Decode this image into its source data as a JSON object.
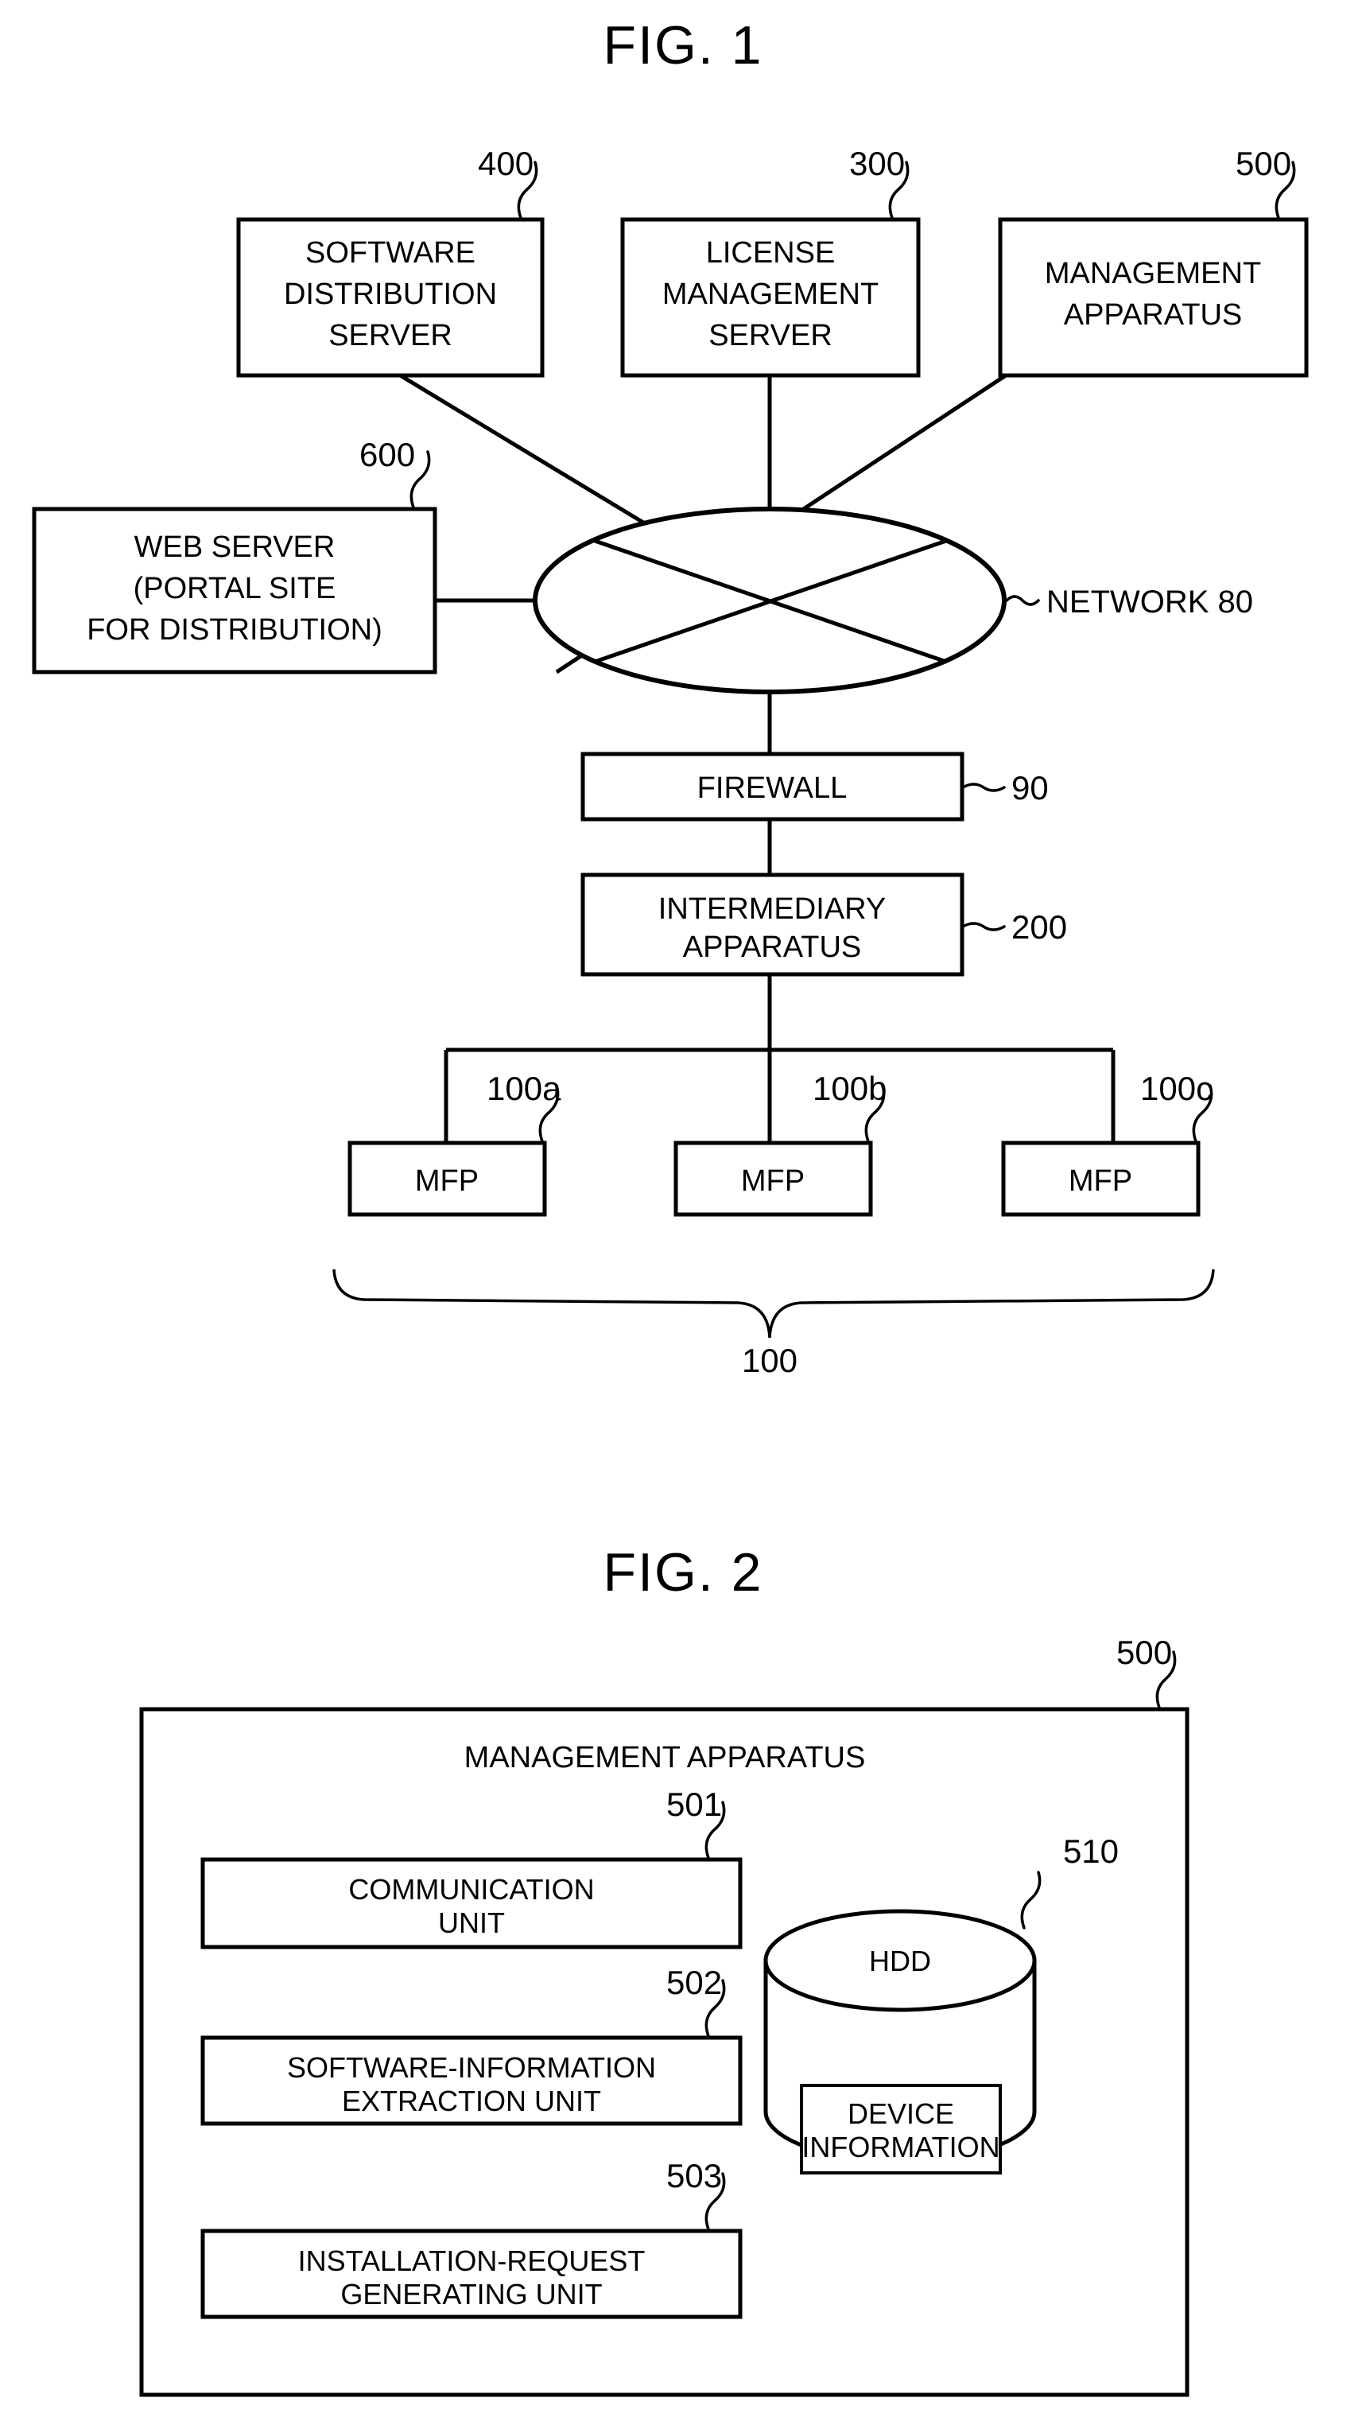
{
  "page": {
    "background": "#ffffff",
    "ink": "#000000"
  },
  "figures": [
    {
      "id": "fig1",
      "title": "FIG. 1",
      "nodes": {
        "software_distribution_server": {
          "label_lines": [
            "SOFTWARE",
            "DISTRIBUTION",
            "SERVER"
          ],
          "ref": "400"
        },
        "license_management_server": {
          "label_lines": [
            "LICENSE",
            "MANAGEMENT",
            "SERVER"
          ],
          "ref": "300"
        },
        "management_apparatus": {
          "label_lines": [
            "MANAGEMENT",
            "APPARATUS"
          ],
          "ref": "500"
        },
        "web_server": {
          "label_lines": [
            "WEB SERVER",
            "(PORTAL SITE",
            "FOR DISTRIBUTION)"
          ],
          "ref": "600"
        },
        "network": {
          "label": "NETWORK 80"
        },
        "firewall": {
          "label_lines": [
            "FIREWALL"
          ],
          "ref": "90"
        },
        "intermediary_apparatus": {
          "label_lines": [
            "INTERMEDIARY",
            "APPARATUS"
          ],
          "ref": "200"
        },
        "mfp_a": {
          "label_lines": [
            "MFP"
          ],
          "ref": "100a"
        },
        "mfp_b": {
          "label_lines": [
            "MFP"
          ],
          "ref": "100b"
        },
        "mfp_c": {
          "label_lines": [
            "MFP"
          ],
          "ref": "100c"
        },
        "mfp_group": {
          "ref": "100"
        }
      }
    },
    {
      "id": "fig2",
      "title": "FIG. 2",
      "nodes": {
        "management_apparatus": {
          "label_lines": [
            "MANAGEMENT APPARATUS"
          ],
          "ref": "500"
        },
        "communication_unit": {
          "label_lines": [
            "COMMUNICATION",
            "UNIT"
          ],
          "ref": "501"
        },
        "software_information_extraction_unit": {
          "label_lines": [
            "SOFTWARE-INFORMATION",
            "EXTRACTION UNIT"
          ],
          "ref": "502"
        },
        "installation_request_generating_unit": {
          "label_lines": [
            "INSTALLATION-REQUEST",
            "GENERATING UNIT"
          ],
          "ref": "503"
        },
        "hdd": {
          "label_lines": [
            "HDD"
          ],
          "ref": "510"
        },
        "device_information": {
          "label_lines": [
            "DEVICE",
            "INFORMATION"
          ]
        }
      }
    }
  ],
  "fig1": {
    "title": "FIG. 1",
    "sds": {
      "l1": "SOFTWARE",
      "l2": "DISTRIBUTION",
      "l3": "SERVER",
      "ref": "400"
    },
    "lms": {
      "l1": "LICENSE",
      "l2": "MANAGEMENT",
      "l3": "SERVER",
      "ref": "300"
    },
    "mgmt": {
      "l1": "MANAGEMENT",
      "l2": "APPARATUS",
      "ref": "500"
    },
    "web": {
      "l1": "WEB SERVER",
      "l2": "(PORTAL SITE",
      "l3": "FOR DISTRIBUTION)",
      "ref": "600"
    },
    "network": {
      "label": "NETWORK 80"
    },
    "firewall": {
      "l1": "FIREWALL",
      "ref": "90"
    },
    "intermediary": {
      "l1": "INTERMEDIARY",
      "l2": "APPARATUS",
      "ref": "200"
    },
    "mfpa": {
      "l1": "MFP",
      "ref": "100a"
    },
    "mfpb": {
      "l1": "MFP",
      "ref": "100b"
    },
    "mfpc": {
      "l1": "MFP",
      "ref": "100c"
    },
    "group": {
      "ref": "100"
    }
  },
  "fig2": {
    "title": "FIG. 2",
    "outer": {
      "l1": "MANAGEMENT APPARATUS",
      "ref": "500"
    },
    "comm": {
      "l1": "COMMUNICATION",
      "l2": "UNIT",
      "ref": "501"
    },
    "extract": {
      "l1": "SOFTWARE-INFORMATION",
      "l2": "EXTRACTION UNIT",
      "ref": "502"
    },
    "install": {
      "l1": "INSTALLATION-REQUEST",
      "l2": "GENERATING UNIT",
      "ref": "503"
    },
    "hdd": {
      "l1": "HDD",
      "ref": "510"
    },
    "devinfo": {
      "l1": "DEVICE",
      "l2": "INFORMATION"
    }
  }
}
